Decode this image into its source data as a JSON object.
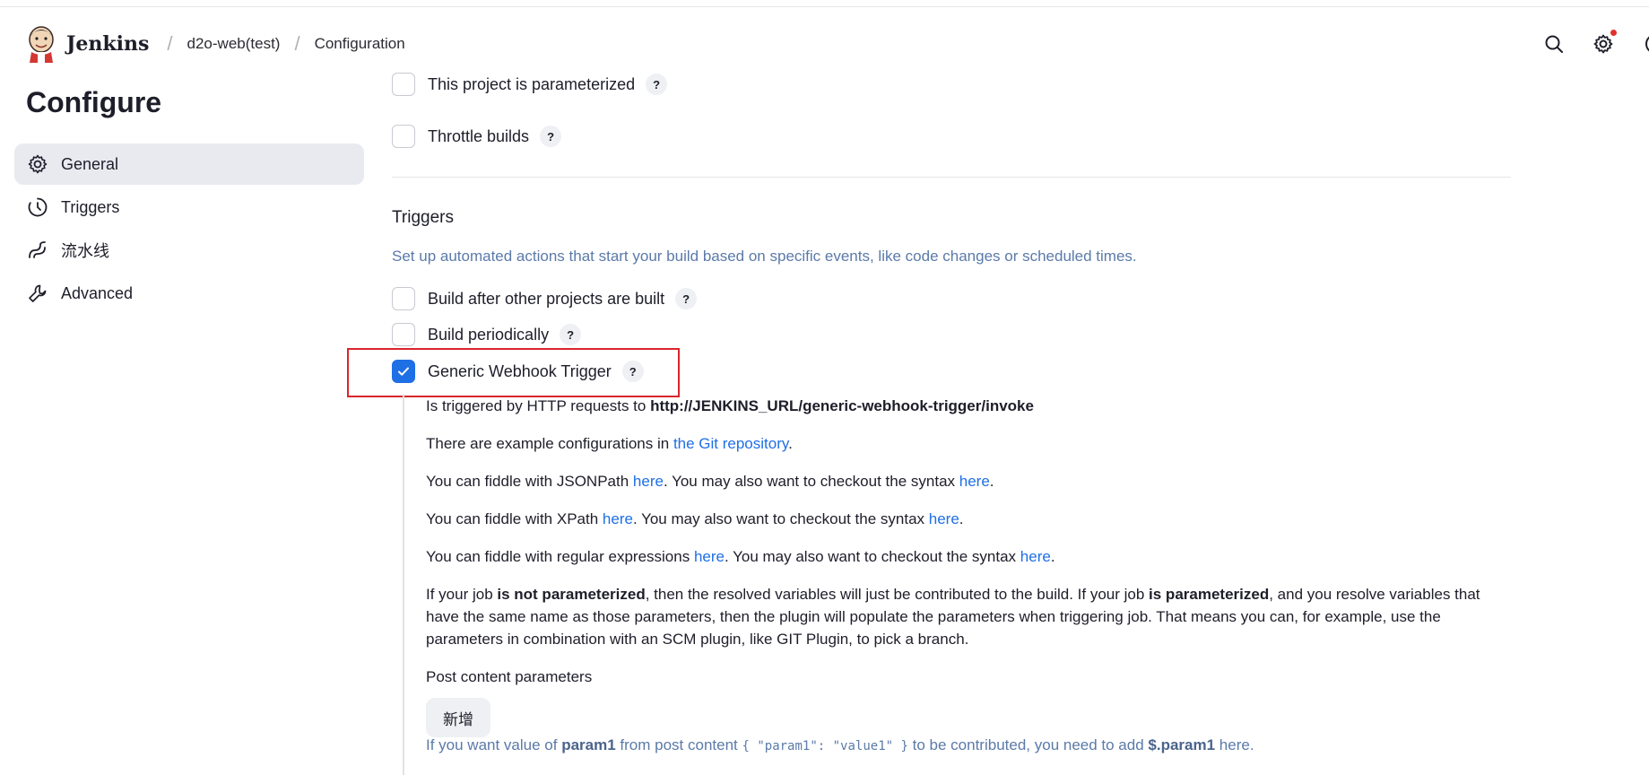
{
  "header": {
    "brand": "Jenkins",
    "breadcrumbs": [
      "d2o-web(test)",
      "Configuration"
    ],
    "separator": "/",
    "icons": [
      "search-icon",
      "gear-icon",
      "user-icon"
    ],
    "notification_color": "#e0312b"
  },
  "sidebar": {
    "title": "Configure",
    "items": [
      {
        "label": "General",
        "icon": "gear-icon",
        "active": true
      },
      {
        "label": "Triggers",
        "icon": "clock-icon",
        "active": false
      },
      {
        "label": "流水线",
        "icon": "pipeline-icon",
        "active": false
      },
      {
        "label": "Advanced",
        "icon": "wrench-icon",
        "active": false
      }
    ]
  },
  "general": {
    "options": [
      {
        "label": "This project is parameterized",
        "checked": false
      },
      {
        "label": "Throttle builds",
        "checked": false
      }
    ]
  },
  "triggers": {
    "title": "Triggers",
    "description": "Set up automated actions that start your build based on specific events, like code changes or scheduled times.",
    "options": [
      {
        "label": "Build after other projects are built",
        "checked": false
      },
      {
        "label": "Build periodically",
        "checked": false
      },
      {
        "label": "Generic Webhook Trigger",
        "checked": true
      }
    ],
    "help_glyph": "?"
  },
  "webhook": {
    "triggered_prefix": "Is triggered by HTTP requests to ",
    "triggered_url": "http://JENKINS_URL/generic-webhook-trigger/invoke",
    "examples_prefix": "There are example configurations in ",
    "examples_link": "the Git repository",
    "examples_suffix": ".",
    "jsonpath_prefix": "You can fiddle with JSONPath ",
    "xpath_prefix": "You can fiddle with XPath ",
    "regex_prefix": "You can fiddle with regular expressions ",
    "here": "here",
    "syntax_middle": ". You may also want to checkout the syntax ",
    "period": ".",
    "param_p1": "If your job ",
    "param_b1": "is not parameterized",
    "param_p2": ", then the resolved variables will just be contributed to the build. If your job ",
    "param_b2": "is parameterized",
    "param_p3": ", and you resolve variables that have the same name as those parameters, then the plugin will populate the parameters when triggering job. That means you can, for example, use the parameters in combination with an SCM plugin, like GIT Plugin, to pick a branch.",
    "post_content_label": "Post content parameters",
    "add_button": "新增",
    "hint_p1": "If you want value of ",
    "hint_b1": "param1",
    "hint_p2": " from post content ",
    "hint_code": "{ \"param1\": \"value1\" }",
    "hint_p3": " to be contributed, you need to add ",
    "hint_b2": "$.param1",
    "hint_p4": " here."
  },
  "colors": {
    "accent": "#1f6fe5",
    "highlight_border": "#d9252b",
    "muted_text": "#5b7aa8"
  }
}
